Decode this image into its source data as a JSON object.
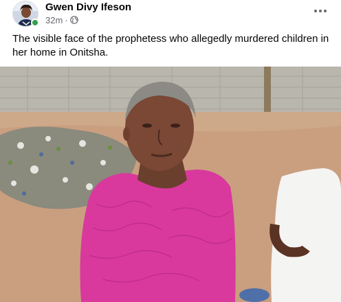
{
  "post": {
    "author_name": "Gwen Divy Ifeson",
    "timestamp": "32m",
    "separator": "·",
    "audience_icon": "globe-icon",
    "more_icon": "more-options-icon",
    "caption": "The visible face of the prophetess who allegedly murdered children in her home in Onitsha."
  },
  "colors": {
    "online_status": "#31a24c",
    "secondary_text": "#65676b",
    "primary_text": "#050505",
    "dress_pink": "#d9399c"
  }
}
